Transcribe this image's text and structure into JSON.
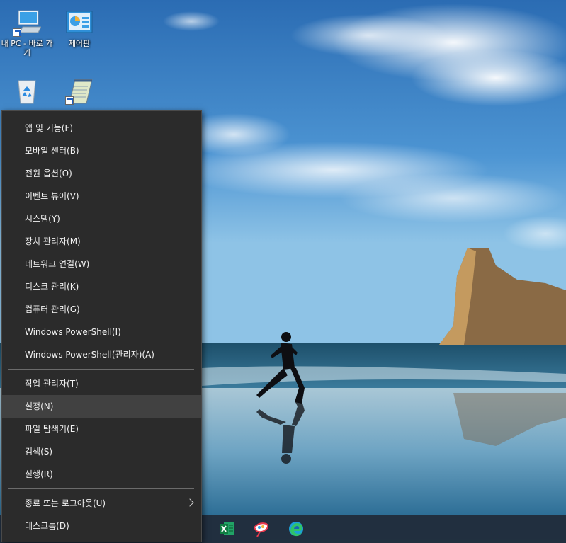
{
  "desktop": {
    "icons": [
      {
        "label": "내 PC - 바로 가기",
        "icon": "this-pc-icon"
      },
      {
        "label": "제어판",
        "icon": "control-panel-icon"
      },
      {
        "label": "",
        "icon": "recycle-bin-icon"
      },
      {
        "label": "",
        "icon": "notepad-icon"
      }
    ]
  },
  "winx_menu": {
    "groups": [
      [
        {
          "label": "앱 및 기능(F)"
        },
        {
          "label": "모바일 센터(B)"
        },
        {
          "label": "전원 옵션(O)"
        },
        {
          "label": "이벤트 뷰어(V)"
        },
        {
          "label": "시스템(Y)"
        },
        {
          "label": "장치 관리자(M)"
        },
        {
          "label": "네트워크 연결(W)"
        },
        {
          "label": "디스크 관리(K)"
        },
        {
          "label": "컴퓨터 관리(G)"
        },
        {
          "label": "Windows PowerShell(I)"
        },
        {
          "label": "Windows PowerShell(관리자)(A)"
        }
      ],
      [
        {
          "label": "작업 관리자(T)"
        },
        {
          "label": "설정(N)",
          "state": "hovered"
        },
        {
          "label": "파일 탐색기(E)"
        },
        {
          "label": "검색(S)"
        },
        {
          "label": "실행(R)"
        }
      ],
      [
        {
          "label": "종료 또는 로그아웃(U)",
          "submenu": true
        },
        {
          "label": "데스크톱(D)"
        }
      ]
    ]
  },
  "taskbar": {
    "apps": [
      {
        "icon": "excel-icon",
        "accent": "#1d6f42"
      },
      {
        "icon": "paint-3d-icon",
        "accent": "#e8394d"
      },
      {
        "icon": "edge-icon",
        "accent": "#1ca0d9"
      }
    ]
  }
}
